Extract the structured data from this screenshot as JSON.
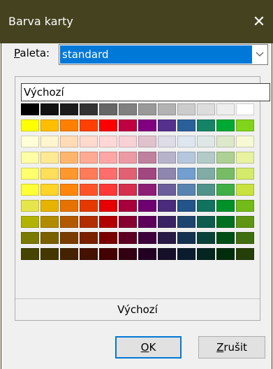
{
  "window": {
    "title": "Barva karty",
    "close_glyph": "✕"
  },
  "palette": {
    "label_mnemonic": "P",
    "label_rest": "aleta:",
    "selected": "standard"
  },
  "default_field": "Výchozí",
  "default_button": "Výchozí",
  "buttons": {
    "ok_mnemonic": "O",
    "ok_rest": "K",
    "cancel_mnemonic": "Z",
    "cancel_rest": "rušit"
  },
  "swatches": [
    [
      "#000000",
      "#111111",
      "#1c1c1c",
      "#333333",
      "#666666",
      "#808080",
      "#999999",
      "#b2b2b2",
      "#cccccc",
      "#dddddd",
      "#eeeeee",
      "#ffffff"
    ],
    [
      "#ffff00",
      "#ffbf00",
      "#ff8000",
      "#ff4000",
      "#ff0000",
      "#bf0041",
      "#800080",
      "#55308d",
      "#2a6099",
      "#158466",
      "#00a933",
      "#81d41a"
    ],
    [
      "#ffffd7",
      "#fff5ce",
      "#ffdbb6",
      "#ffd8ce",
      "#ffd7d7",
      "#f7d1d5",
      "#e0c2cd",
      "#dedce6",
      "#dee6ef",
      "#dee7e5",
      "#dde8cb",
      "#f6f9d4"
    ],
    [
      "#ffffa6",
      "#ffe994",
      "#ffb66c",
      "#ffaa95",
      "#ffa6a6",
      "#ec9ba4",
      "#bf819e",
      "#b7b3ca",
      "#b4c7dc",
      "#b3cac7",
      "#afd095",
      "#e8f2a1"
    ],
    [
      "#ffff6d",
      "#ffde59",
      "#ff972f",
      "#ff7b59",
      "#ff6d6d",
      "#e16173",
      "#a1467e",
      "#8e86ae",
      "#729fcf",
      "#81aca6",
      "#77bc65",
      "#d4ea6b"
    ],
    [
      "#ffff38",
      "#ffd428",
      "#ff860d",
      "#ff5429",
      "#ff3838",
      "#d62e4e",
      "#8d1d75",
      "#6b5e9b",
      "#5983b0",
      "#50938a",
      "#3faf46",
      "#c9e23f"
    ],
    [
      "#e6e64c",
      "#e6b400",
      "#e67300",
      "#e63900",
      "#e60000",
      "#a8003a",
      "#6e0070",
      "#4a2b7c",
      "#23548a",
      "#127260",
      "#009129",
      "#73bb18"
    ],
    [
      "#b2b300",
      "#b28c00",
      "#b25900",
      "#b22d00",
      "#b20000",
      "#860030",
      "#5c0059",
      "#3a2364",
      "#1c446e",
      "#0d5c4c",
      "#007020",
      "#5e9614"
    ],
    [
      "#7a7a00",
      "#7a6000",
      "#7a3d00",
      "#7a1f00",
      "#7a0000",
      "#5e0022",
      "#3e003d",
      "#281947",
      "#143150",
      "#094238",
      "#004f16",
      "#416e0e"
    ],
    [
      "#454500",
      "#453700",
      "#452200",
      "#451100",
      "#450000",
      "#330012",
      "#230023",
      "#17102a",
      "#0b1c2e",
      "#052620",
      "#002d0c",
      "#253f08"
    ]
  ]
}
